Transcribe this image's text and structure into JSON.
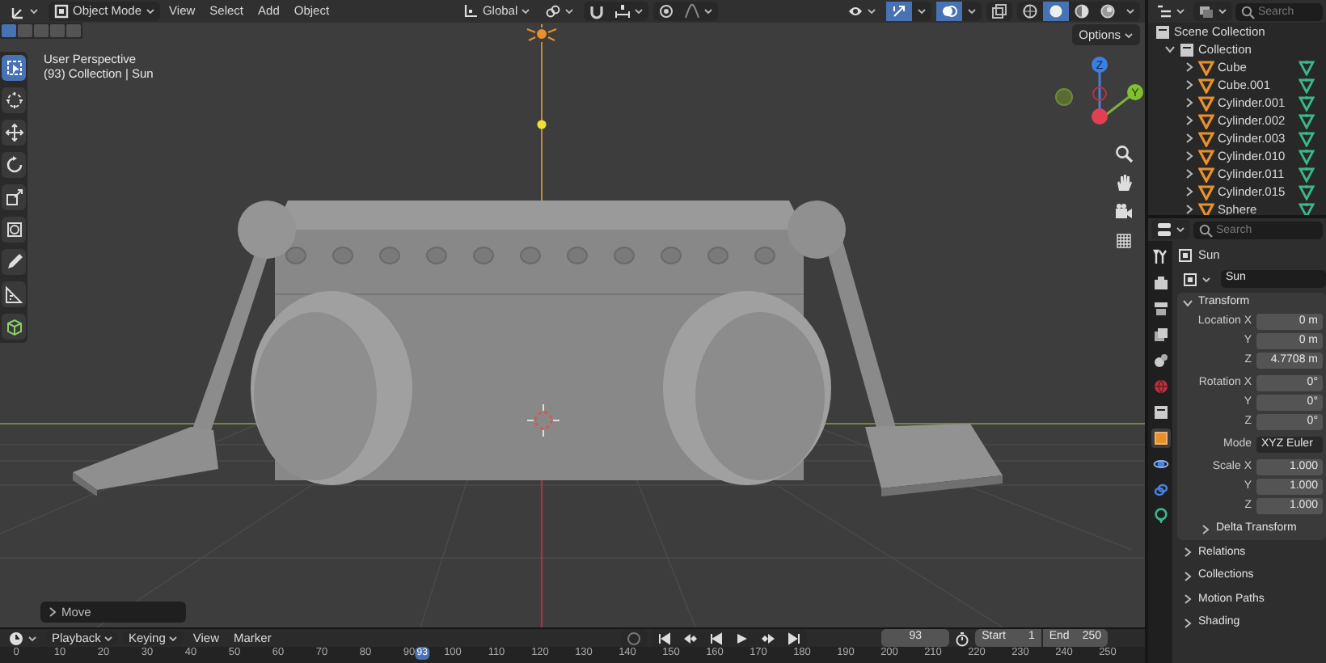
{
  "viewport": {
    "header": {
      "mode": "Object Mode",
      "menus": [
        "View",
        "Select",
        "Add",
        "Object"
      ],
      "orientation": "Global",
      "shading_modes": [
        {
          "selected": false
        },
        {
          "selected": true
        },
        {
          "selected": false
        },
        {
          "selected": false
        }
      ]
    },
    "select_modes": [
      {
        "selected": true
      },
      {
        "selected": false
      },
      {
        "selected": false
      },
      {
        "selected": false
      },
      {
        "selected": false
      }
    ],
    "tools": [
      {
        "kind": "select",
        "selected": true
      },
      {
        "kind": "cursor",
        "selected": false
      },
      {
        "kind": "move",
        "selected": false
      },
      {
        "kind": "rotate",
        "selected": false
      },
      {
        "kind": "scale",
        "selected": false
      },
      {
        "kind": "transform",
        "selected": false
      },
      {
        "kind": "annotate",
        "selected": false
      },
      {
        "kind": "measure",
        "selected": false
      },
      {
        "kind": "add",
        "selected": false
      }
    ],
    "info": [
      "User Perspective",
      "(93) Collection | Sun"
    ],
    "options": "Options",
    "gizmo": {
      "z": "Z",
      "y": "Y"
    },
    "last_operator": "Move"
  },
  "timeline": {
    "menus": [
      "Playback",
      "Keying",
      "View",
      "Marker"
    ],
    "current_frame": "93",
    "start_label": "Start",
    "start": "1",
    "end_label": "End",
    "end": "250",
    "ruler": [
      "0",
      "10",
      "20",
      "30",
      "40",
      "50",
      "60",
      "70",
      "80",
      "90",
      "100",
      "110",
      "120",
      "130",
      "140",
      "150",
      "160",
      "170",
      "180",
      "190",
      "200",
      "210",
      "220",
      "230",
      "240",
      "250"
    ],
    "ruler_current": "93"
  },
  "outliner": {
    "search_placeholder": "Search",
    "root": "Scene Collection",
    "collection": {
      "label": "Collection",
      "expanded": true,
      "children": [
        {
          "label": "Cube",
          "expanded": false
        },
        {
          "label": "Cube.001",
          "expanded": false
        },
        {
          "label": "Cylinder.001",
          "expanded": false
        },
        {
          "label": "Cylinder.002",
          "expanded": false
        },
        {
          "label": "Cylinder.003",
          "expanded": false
        },
        {
          "label": "Cylinder.010",
          "expanded": false
        },
        {
          "label": "Cylinder.011",
          "expanded": false
        },
        {
          "label": "Cylinder.015",
          "expanded": false
        },
        {
          "label": "Sphere",
          "expanded": false
        }
      ]
    }
  },
  "properties": {
    "search_placeholder": "Search",
    "tabs": [
      {
        "kind": "tool",
        "selected": false
      },
      {
        "kind": "render",
        "selected": false
      },
      {
        "kind": "output",
        "selected": false
      },
      {
        "kind": "view-layer",
        "selected": false
      },
      {
        "kind": "scene",
        "selected": false
      },
      {
        "kind": "world",
        "selected": false
      },
      {
        "kind": "collection",
        "selected": false
      },
      {
        "kind": "object",
        "selected": true
      },
      {
        "kind": "physics",
        "selected": false
      },
      {
        "kind": "constraints",
        "selected": false
      },
      {
        "kind": "light",
        "selected": false
      }
    ],
    "context": "Sun",
    "datablock": "Sun",
    "transform": {
      "title": "Transform",
      "expanded": true,
      "groups": [
        [
          {
            "label": "Location X",
            "value": "0 m"
          },
          {
            "label": "Y",
            "value": "0 m"
          },
          {
            "label": "Z",
            "value": "4.7708 m"
          }
        ],
        [
          {
            "label": "Rotation X",
            "value": "0°"
          },
          {
            "label": "Y",
            "value": "0°"
          },
          {
            "label": "Z",
            "value": "0°"
          }
        ],
        [
          {
            "label": "Mode",
            "value": "XYZ Euler",
            "kind": "dropdown"
          }
        ],
        [
          {
            "label": "Scale X",
            "value": "1.000"
          },
          {
            "label": "Y",
            "value": "1.000"
          },
          {
            "label": "Z",
            "value": "1.000"
          }
        ]
      ],
      "subpanel": {
        "title": "Delta Transform",
        "expanded": false
      }
    },
    "panels": [
      {
        "title": "Relations",
        "expanded": false
      },
      {
        "title": "Collections",
        "expanded": false
      },
      {
        "title": "Motion Paths",
        "expanded": false
      },
      {
        "title": "Shading",
        "expanded": false
      }
    ]
  }
}
